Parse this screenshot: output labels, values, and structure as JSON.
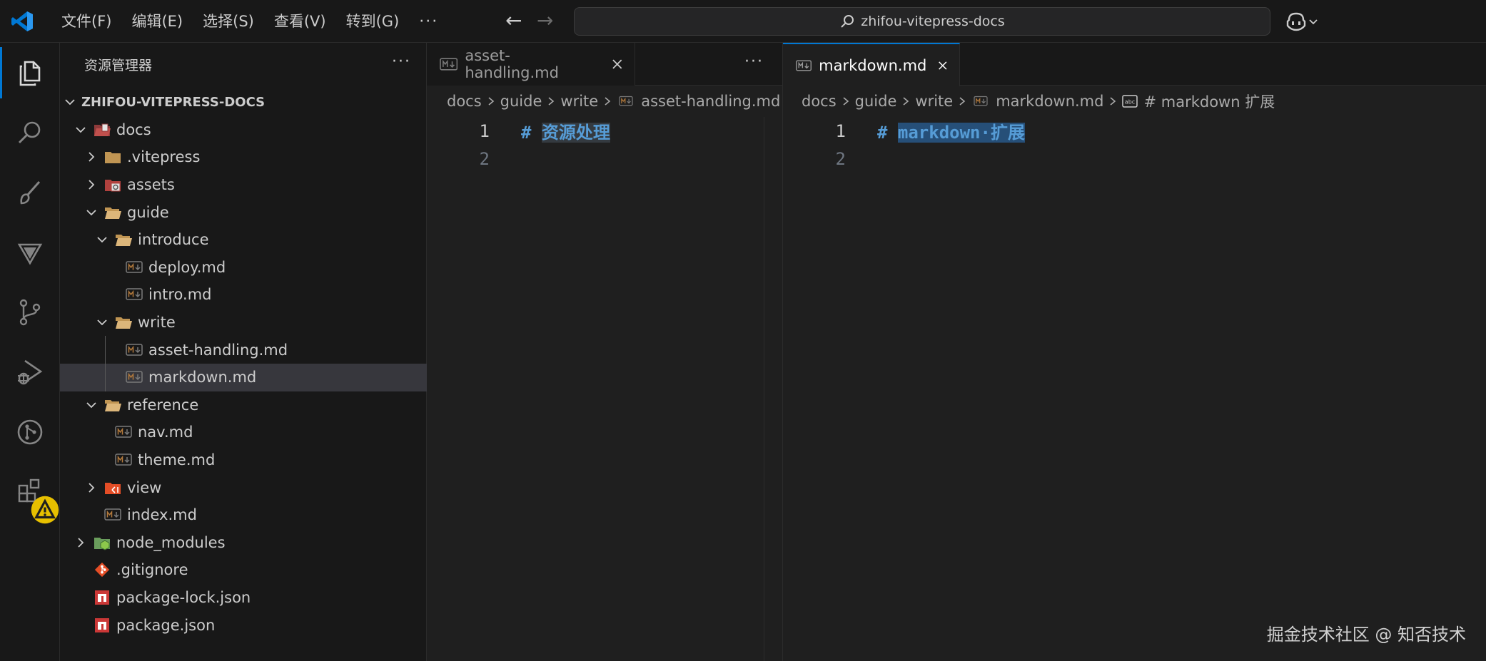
{
  "titlebar": {
    "menu": [
      "文件(F)",
      "编辑(E)",
      "选择(S)",
      "查看(V)",
      "转到(G)"
    ],
    "more": "···",
    "search_text": "zhifou-vitepress-docs"
  },
  "colors": {
    "accent": "#0078d4",
    "folder": "#dcb67a",
    "md_icon": "#7a7a7a",
    "heading": "#569cd6",
    "npm_red": "#cb3837",
    "git_orange": "#e44d26",
    "warning": "#e7c000"
  },
  "activity": [
    "files-icon",
    "search-icon",
    "paintbrush-icon",
    "triangle-icon",
    "source-control-icon",
    "run-debug-icon",
    "git-graph-icon",
    "extensions-icon"
  ],
  "sidebar": {
    "title": "资源管理器",
    "more": "···",
    "tree": [
      {
        "label": "ZHIFOU-VITEPRESS-DOCS",
        "depth": 0,
        "chevron": "down",
        "icon": "none",
        "root": true
      },
      {
        "label": "docs",
        "depth": 1,
        "chevron": "down",
        "icon": "folder-docs"
      },
      {
        "label": ".vitepress",
        "depth": 2,
        "chevron": "right",
        "icon": "folder"
      },
      {
        "label": "assets",
        "depth": 2,
        "chevron": "right",
        "icon": "folder-assets"
      },
      {
        "label": "guide",
        "depth": 2,
        "chevron": "down",
        "icon": "folder-open"
      },
      {
        "label": "introduce",
        "depth": 3,
        "chevron": "down",
        "icon": "folder-open"
      },
      {
        "label": "deploy.md",
        "depth": 4,
        "chevron": "none",
        "icon": "md"
      },
      {
        "label": "intro.md",
        "depth": 4,
        "chevron": "none",
        "icon": "md"
      },
      {
        "label": "write",
        "depth": 3,
        "chevron": "down",
        "icon": "folder-open"
      },
      {
        "label": "asset-handling.md",
        "depth": 4,
        "chevron": "none",
        "icon": "md"
      },
      {
        "label": "markdown.md",
        "depth": 4,
        "chevron": "none",
        "icon": "md",
        "selected": true
      },
      {
        "label": "reference",
        "depth": 2,
        "chevron": "down",
        "icon": "folder-open"
      },
      {
        "label": "nav.md",
        "depth": 3,
        "chevron": "none",
        "icon": "md"
      },
      {
        "label": "theme.md",
        "depth": 3,
        "chevron": "none",
        "icon": "md"
      },
      {
        "label": "view",
        "depth": 2,
        "chevron": "right",
        "icon": "folder-view"
      },
      {
        "label": "index.md",
        "depth": 2,
        "chevron": "none",
        "icon": "md"
      },
      {
        "label": "node_modules",
        "depth": 1,
        "chevron": "right",
        "icon": "folder-node"
      },
      {
        "label": ".gitignore",
        "depth": 1,
        "chevron": "none",
        "icon": "git"
      },
      {
        "label": "package-lock.json",
        "depth": 1,
        "chevron": "none",
        "icon": "npm"
      },
      {
        "label": "package.json",
        "depth": 1,
        "chevron": "none",
        "icon": "npm"
      }
    ]
  },
  "editor_left": {
    "tab_label": "asset-handling.md",
    "more": "···",
    "breadcrumb": [
      "docs",
      "guide",
      "write",
      "asset-handling.md"
    ],
    "lines": [
      {
        "num": "1",
        "marker": "# ",
        "text": "资源处理"
      },
      {
        "num": "2",
        "marker": "",
        "text": ""
      }
    ]
  },
  "editor_right": {
    "tab_label": "markdown.md",
    "breadcrumb": [
      "docs",
      "guide",
      "write",
      "markdown.md",
      "# markdown 扩展"
    ],
    "lines": [
      {
        "num": "1",
        "marker": "# ",
        "text": "markdown·扩展"
      },
      {
        "num": "2",
        "marker": "",
        "text": ""
      }
    ]
  },
  "watermark": "掘金技术社区 @ 知否技术"
}
